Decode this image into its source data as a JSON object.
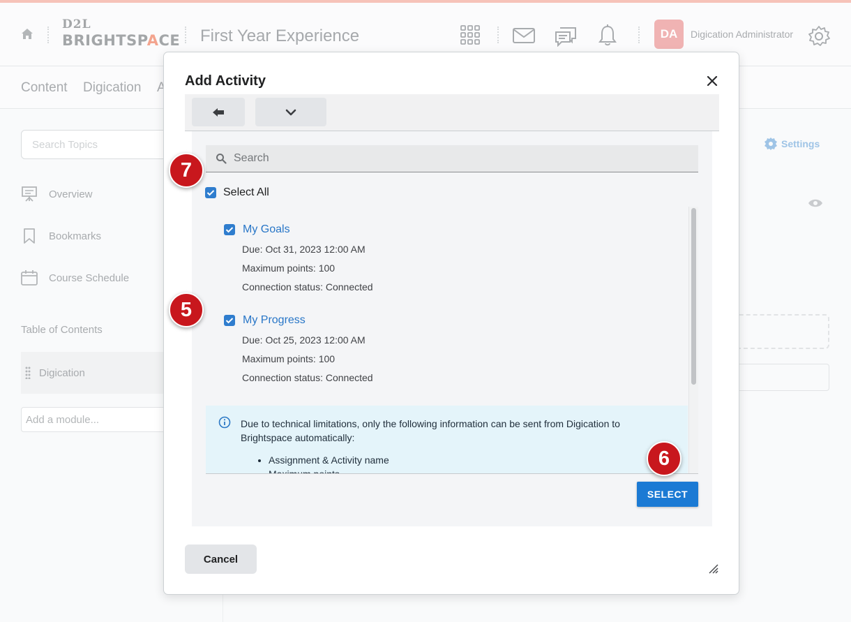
{
  "header": {
    "logo_top": "D2L",
    "logo_bottom_pre": "BRIGHTSP",
    "logo_bottom_accent": "A",
    "logo_bottom_post": "CE",
    "course_title": "First Year Experience",
    "user_initials": "DA",
    "user_name": "Digication Administrator"
  },
  "nav": {
    "items": [
      "Content",
      "Digication",
      "A"
    ]
  },
  "sidebar": {
    "search_placeholder": "Search Topics",
    "items": [
      {
        "label": "Overview",
        "icon": "presentation-icon"
      },
      {
        "label": "Bookmarks",
        "icon": "bookmark-icon"
      },
      {
        "label": "Course Schedule",
        "icon": "calendar-icon"
      }
    ],
    "toc_label": "Table of Contents",
    "module_name": "Digication",
    "add_module_placeholder": "Add a module..."
  },
  "main": {
    "settings_label": "Settings"
  },
  "dialog": {
    "title": "Add Activity",
    "search_placeholder": "Search",
    "select_all_label": "Select All",
    "activities": [
      {
        "title": "My Goals",
        "due": "Due: Oct 31, 2023 12:00 AM",
        "points": "Maximum points: 100",
        "status": "Connection status: Connected",
        "checked": true
      },
      {
        "title": "My Progress",
        "due": "Due: Oct 25, 2023 12:00 AM",
        "points": "Maximum points: 100",
        "status": "Connection status: Connected",
        "checked": true
      }
    ],
    "info_text": "Due to technical limitations, only the following information can be sent from Digication to Brightspace automatically:",
    "info_items": [
      "Assignment & Activity name",
      "Maximum points"
    ],
    "select_button": "SELECT",
    "cancel_button": "Cancel"
  },
  "badges": {
    "seven": "7",
    "five": "5",
    "six": "6"
  },
  "colors": {
    "accent_blue": "#1b7ad4",
    "badge_red": "#c8171d",
    "avatar_bg": "#f0b3b3",
    "info_bg": "#e4f4fa"
  }
}
